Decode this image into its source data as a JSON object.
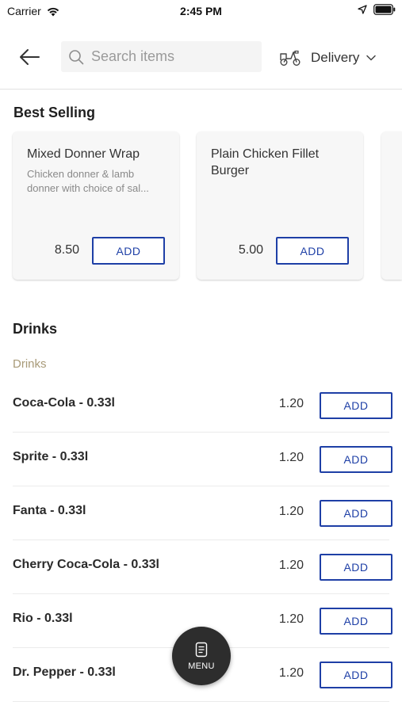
{
  "status_bar": {
    "carrier": "Carrier",
    "time": "2:45 PM"
  },
  "header": {
    "search": {
      "placeholder": "Search items",
      "value": ""
    },
    "delivery_mode": "Delivery"
  },
  "best_selling": {
    "title": "Best Selling",
    "items": [
      {
        "name": "Mixed Donner Wrap",
        "description": "Chicken donner & lamb donner with choice of sal...",
        "price": "8.50",
        "add_label": "ADD"
      },
      {
        "name": "Plain Chicken Fillet Burger",
        "description": "",
        "price": "5.00",
        "add_label": "ADD"
      }
    ]
  },
  "drinks": {
    "title": "Drinks",
    "subtitle": "Drinks",
    "items": [
      {
        "name": "Coca-Cola - 0.33l",
        "price": "1.20",
        "add_label": "ADD"
      },
      {
        "name": "Sprite - 0.33l",
        "price": "1.20",
        "add_label": "ADD"
      },
      {
        "name": "Fanta - 0.33l",
        "price": "1.20",
        "add_label": "ADD"
      },
      {
        "name": "Cherry Coca-Cola - 0.33l",
        "price": "1.20",
        "add_label": "ADD"
      },
      {
        "name": "Rio - 0.33l",
        "price": "1.20",
        "add_label": "ADD"
      },
      {
        "name": "Dr. Pepper - 0.33l",
        "price": "1.20",
        "add_label": "ADD"
      }
    ]
  },
  "menu_button": {
    "label": "MENU",
    "icon": "menu-icon"
  },
  "colors": {
    "accent": "#1e3fa6",
    "subheading": "#a89a78",
    "fab": "#2d2d2d"
  }
}
